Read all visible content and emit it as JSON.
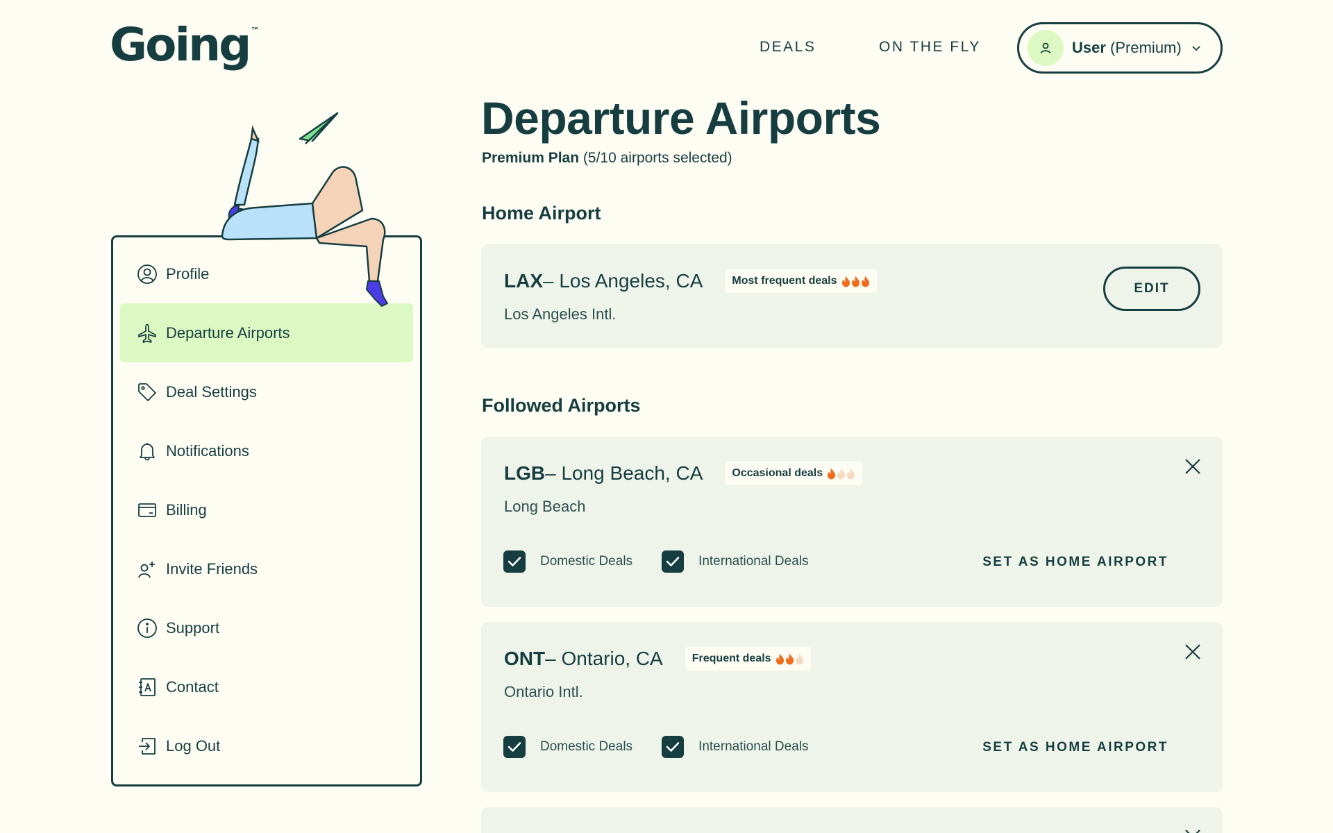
{
  "header": {
    "logo": "Going",
    "logo_tm": "™",
    "nav": {
      "deals": "DEALS",
      "on_the_fly": "ON THE FLY"
    },
    "user": {
      "name": "User",
      "plan": "(Premium)"
    }
  },
  "sidebar": {
    "items": [
      {
        "label": "Profile",
        "icon": "user-circle-icon"
      },
      {
        "label": "Departure Airports",
        "icon": "airplane-icon",
        "active": true
      },
      {
        "label": "Deal Settings",
        "icon": "tag-icon"
      },
      {
        "label": "Notifications",
        "icon": "bell-icon"
      },
      {
        "label": "Billing",
        "icon": "credit-card-icon"
      },
      {
        "label": "Invite Friends",
        "icon": "user-plus-icon"
      },
      {
        "label": "Support",
        "icon": "info-icon"
      },
      {
        "label": "Contact",
        "icon": "address-book-icon"
      },
      {
        "label": "Log Out",
        "icon": "logout-icon"
      }
    ]
  },
  "main": {
    "title": "Departure Airports",
    "plan_name": "Premium Plan",
    "plan_detail": "(5/10 airports selected)",
    "home_heading": "Home Airport",
    "followed_heading": "Followed Airports",
    "home_airport": {
      "code": "LAX",
      "city": " – Los Angeles, CA",
      "badge": "Most frequent deals",
      "flames_lit": 3,
      "name": "Los Angeles Intl.",
      "edit_label": "EDIT"
    },
    "followed": [
      {
        "code": "LGB",
        "city": " – Long Beach, CA",
        "badge": "Occasional deals",
        "flames_lit": 1,
        "name": "Long Beach",
        "domestic_label": "Domestic Deals",
        "international_label": "International Deals",
        "domestic_checked": true,
        "international_checked": true,
        "set_home_label": "SET AS HOME AIRPORT"
      },
      {
        "code": "ONT",
        "city": " – Ontario, CA",
        "badge": "Frequent deals",
        "flames_lit": 2,
        "name": "Ontario Intl.",
        "domestic_label": "Domestic Deals",
        "international_label": "International Deals",
        "domestic_checked": true,
        "international_checked": true,
        "set_home_label": "SET AS HOME AIRPORT"
      }
    ]
  },
  "colors": {
    "background": "#FEFDF4",
    "primary": "#163D3F",
    "accent_green": "#DDF9C3",
    "card": "#EEF4EA",
    "flame_lit": "#F26B1D",
    "flame_dim": "#F6D9C2"
  }
}
